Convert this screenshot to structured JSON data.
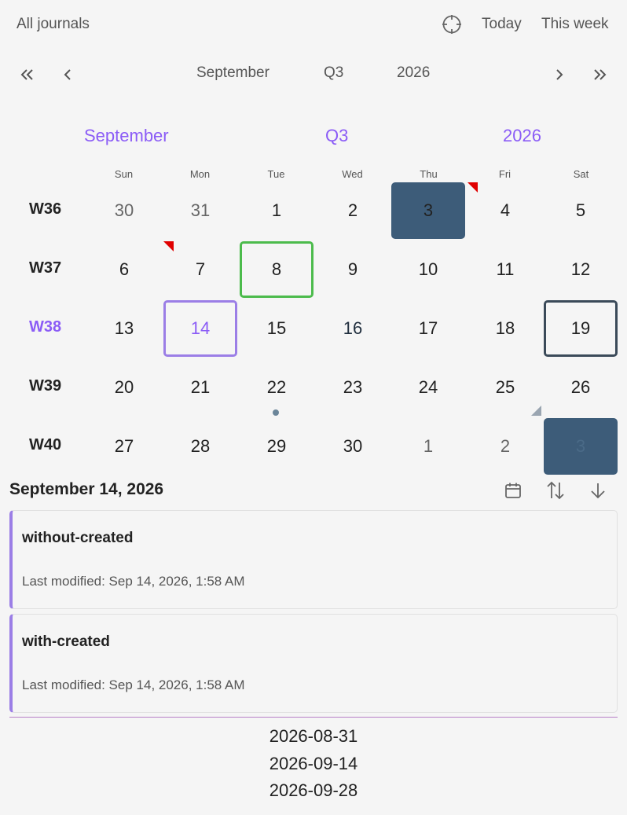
{
  "topbar": {
    "all_journals": "All journals",
    "target_icon": "crosshair-icon",
    "today": "Today",
    "this_week": "This week"
  },
  "nav": {
    "first_icon": "double-chevron-left-icon",
    "prev_icon": "chevron-left-icon",
    "month": "September",
    "quarter": "Q3",
    "year": "2026",
    "next_icon": "chevron-right-icon",
    "last_icon": "double-chevron-right-icon"
  },
  "titles": {
    "month": "September",
    "quarter": "Q3",
    "year": "2026"
  },
  "weekdays": [
    "Sun",
    "Mon",
    "Tue",
    "Wed",
    "Thu",
    "Fri",
    "Sat"
  ],
  "weeks": [
    {
      "label": "W36",
      "days": [
        "30",
        "31",
        "1",
        "2",
        "3",
        "4",
        "5"
      ]
    },
    {
      "label": "W37",
      "days": [
        "6",
        "7",
        "8",
        "9",
        "10",
        "11",
        "12"
      ]
    },
    {
      "label": "W38",
      "days": [
        "13",
        "14",
        "15",
        "16",
        "17",
        "18",
        "19"
      ]
    },
    {
      "label": "W39",
      "days": [
        "20",
        "21",
        "22",
        "23",
        "24",
        "25",
        "26"
      ]
    },
    {
      "label": "W40",
      "days": [
        "27",
        "28",
        "29",
        "30",
        "1",
        "2",
        "3"
      ]
    }
  ],
  "colors": {
    "accent": "#8b5cf6",
    "filled": "#3d5c79",
    "today_border": "#4cbb4c",
    "flag_red": "#e00000"
  },
  "selected": {
    "title": "September 14, 2026",
    "calendar_icon": "calendar-icon",
    "sort_icon": "sort-arrows-icon",
    "down_icon": "arrow-down-icon"
  },
  "notes": [
    {
      "title": "without-created",
      "modified": "Last modified: Sep 14, 2026, 1:58 AM"
    },
    {
      "title": "with-created",
      "modified": "Last modified: Sep 14, 2026, 1:58 AM"
    }
  ],
  "dates": [
    "2026-08-31",
    "2026-09-14",
    "2026-09-28"
  ]
}
